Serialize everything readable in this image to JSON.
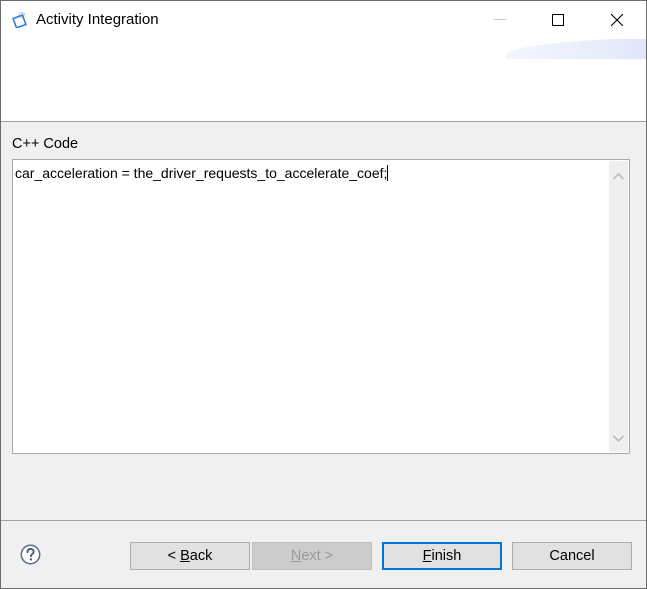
{
  "window": {
    "title": "Activity Integration",
    "icons": {
      "app": "activity-diamond-icon",
      "minimize": "minimize-icon",
      "maximize": "maximize-icon",
      "close": "close-icon"
    }
  },
  "form": {
    "code_label": "C++ Code",
    "code_value": "car_acceleration = the_driver_requests_to_accelerate_coef;"
  },
  "footer": {
    "help_icon": "help-question-icon",
    "buttons": {
      "back": {
        "prefix": "< ",
        "mnemonic": "B",
        "rest": "ack",
        "enabled": true
      },
      "next": {
        "prefix": "",
        "mnemonic": "N",
        "rest": "ext >",
        "enabled": false
      },
      "finish": {
        "prefix": "",
        "mnemonic": "F",
        "rest": "inish",
        "enabled": true,
        "default": true
      },
      "cancel": {
        "label": "Cancel",
        "enabled": true
      }
    }
  },
  "colors": {
    "focus_border": "#0078d7",
    "dialog_bg": "#f0f0f0"
  }
}
